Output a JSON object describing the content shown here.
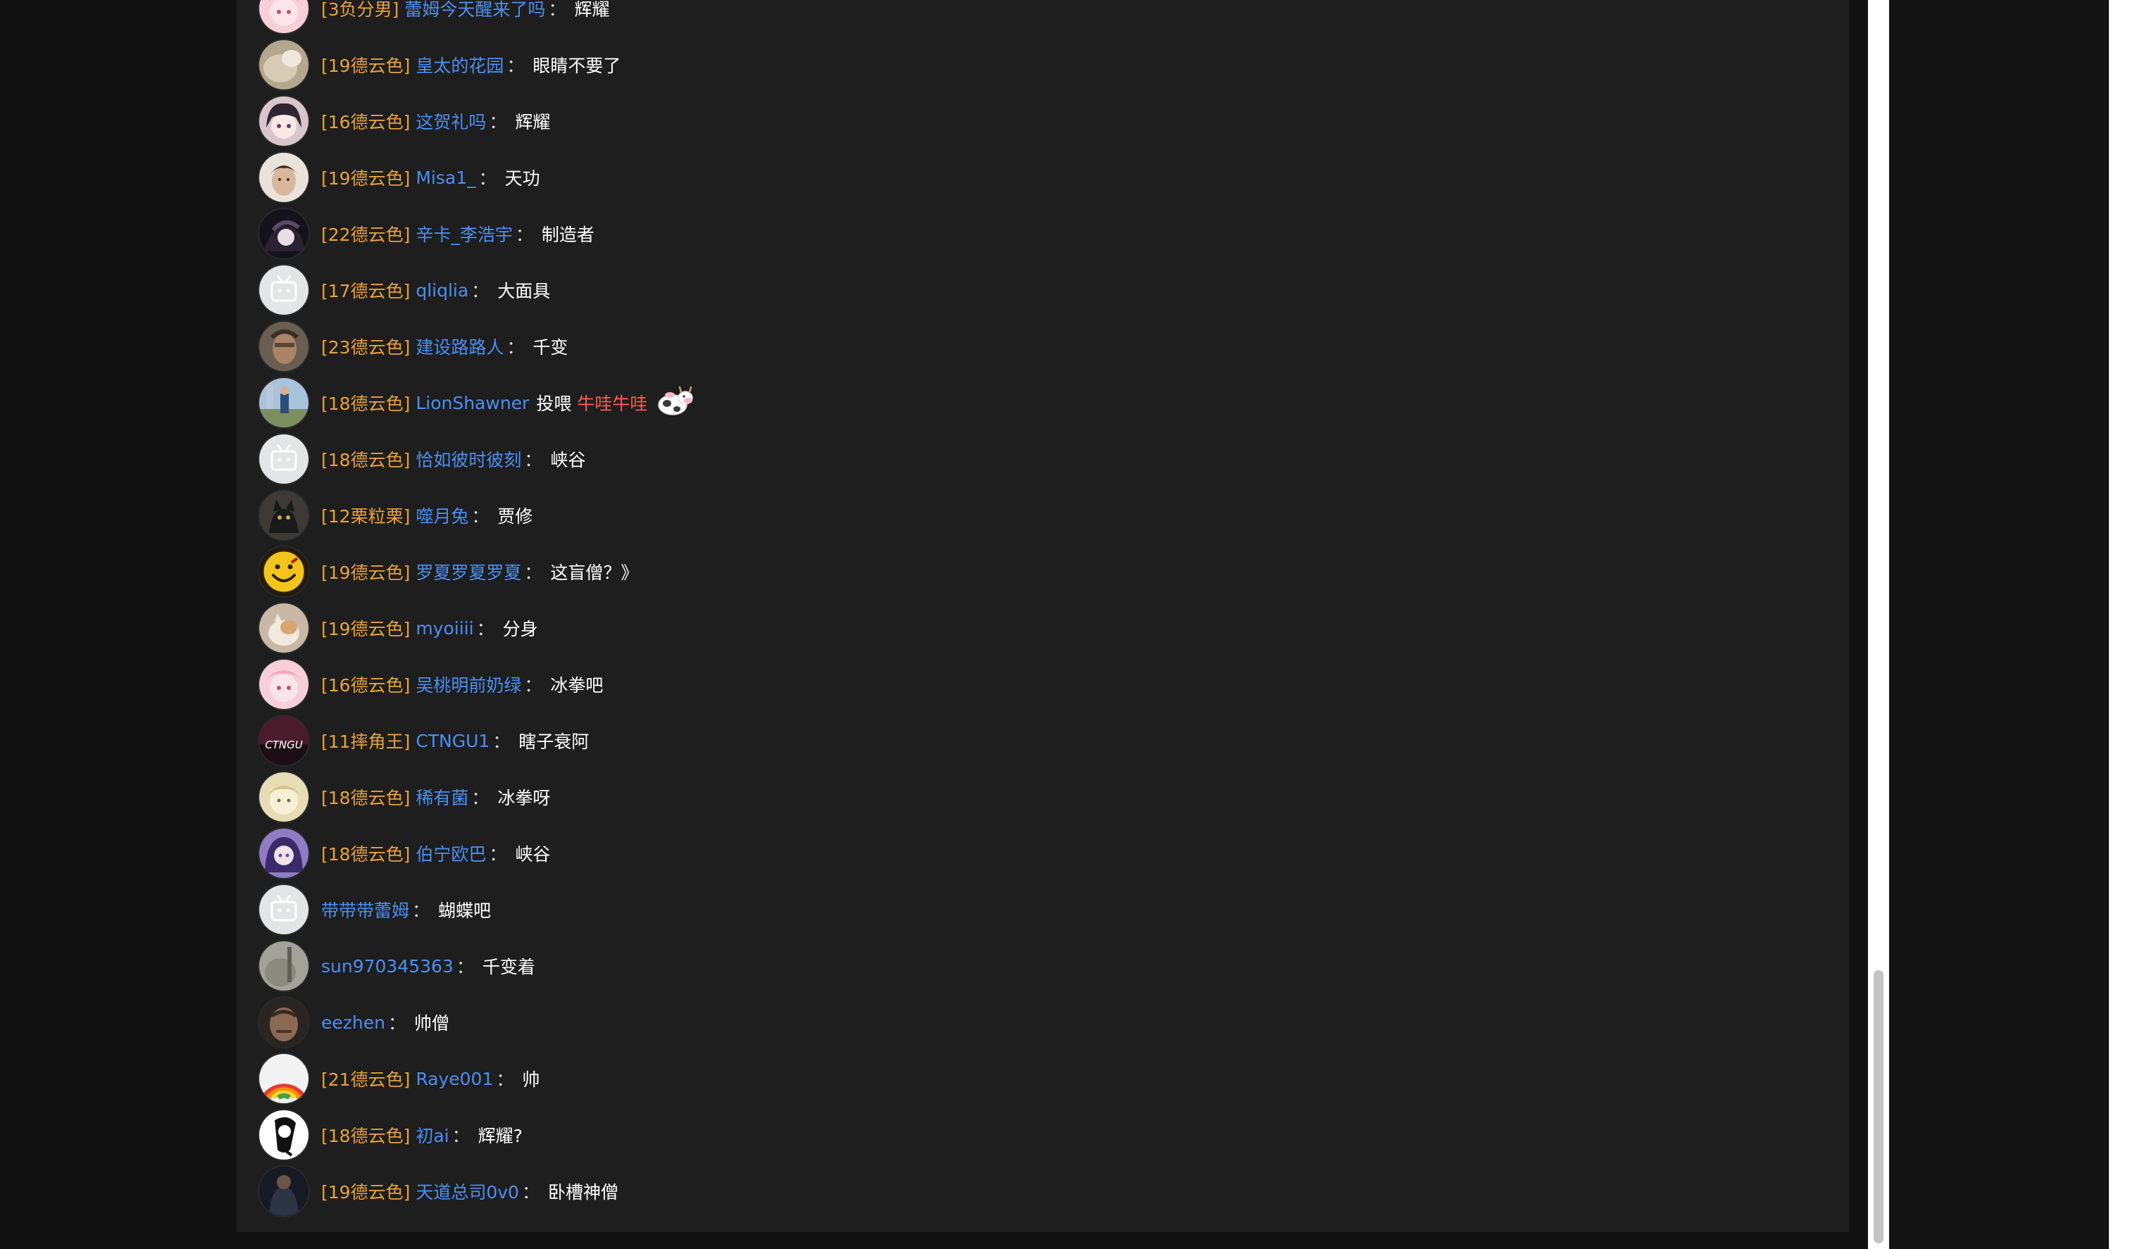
{
  "messages": [
    {
      "badge": "[3负分男]",
      "user": "蕾姆今天醒来了吗",
      "sep": "：",
      "text": "辉耀",
      "avatar": "avatar-pink-anime"
    },
    {
      "badge": "[19德云色]",
      "user": "皇太的花园",
      "sep": "：",
      "text": "眼睛不要了",
      "avatar": "avatar-beige-photo"
    },
    {
      "badge": "[16德云色]",
      "user": "这贺礼吗",
      "sep": "：",
      "text": "辉耀",
      "avatar": "avatar-anime-girl"
    },
    {
      "badge": "[19德云色]",
      "user": "Misa1_",
      "sep": "：",
      "text": "天功",
      "avatar": "avatar-face-photo"
    },
    {
      "badge": "[22德云色]",
      "user": "辛卡_李浩宇",
      "sep": "：",
      "text": "制造者",
      "avatar": "avatar-dark-anime"
    },
    {
      "badge": "[17德云色]",
      "user": "qliqlia",
      "sep": "：",
      "text": "大面具",
      "avatar": "avatar-default-tv"
    },
    {
      "badge": "[23德云色]",
      "user": "建设路路人",
      "sep": "：",
      "text": "千变",
      "avatar": "avatar-man-photo"
    },
    {
      "badge": "[18德云色]",
      "user": "LionShawner",
      "sep": "",
      "text": "",
      "gift_verb": "投喂",
      "gift_name": "牛哇牛哇",
      "avatar": "avatar-outdoor-photo",
      "gift_icon": "cow-gift-icon"
    },
    {
      "badge": "[18德云色]",
      "user": "恰如彼时彼刻",
      "sep": "：",
      "text": "峡谷",
      "avatar": "avatar-default-tv"
    },
    {
      "badge": "[12栗粒栗]",
      "user": "噬月兔",
      "sep": "：",
      "text": "贾修",
      "avatar": "avatar-black-cat"
    },
    {
      "badge": "[19德云色]",
      "user": "罗夏罗夏罗夏",
      "sep": "：",
      "text": "这盲僧？》",
      "avatar": "avatar-smiley"
    },
    {
      "badge": "[19德云色]",
      "user": "myoiiii",
      "sep": "：",
      "text": "分身",
      "avatar": "avatar-cat-photo"
    },
    {
      "badge": "[16德云色]",
      "user": "吴桃明前奶绿",
      "sep": "：",
      "text": "冰拳吧",
      "avatar": "avatar-pink-anime"
    },
    {
      "badge": "[11摔角王]",
      "user": "CTNGU1",
      "sep": "：",
      "text": "瞎子衰阿",
      "avatar": "avatar-ctngu-logo",
      "avatar_text": "CTNGU"
    },
    {
      "badge": "[18德云色]",
      "user": "稀有菌",
      "sep": "：",
      "text": "冰拳呀",
      "avatar": "avatar-cream-anime"
    },
    {
      "badge": "[18德云色]",
      "user": "伯宁欧巴",
      "sep": "：",
      "text": "峡谷",
      "avatar": "avatar-purple-anime"
    },
    {
      "badge": "",
      "user": "带带带蕾姆",
      "sep": "：",
      "text": "蝴蝶吧",
      "avatar": "avatar-default-tv"
    },
    {
      "badge": "",
      "user": "sun970345363",
      "sep": "：",
      "text": "千变着",
      "avatar": "avatar-gray-photo"
    },
    {
      "badge": "",
      "user": "eezhen",
      "sep": "：",
      "text": "帅僧",
      "avatar": "avatar-man-dark-photo"
    },
    {
      "badge": "[21德云色]",
      "user": "Raye001",
      "sep": "：",
      "text": "帅",
      "avatar": "avatar-rainbow"
    },
    {
      "badge": "[18德云色]",
      "user": "初ai",
      "sep": "：",
      "text": "辉耀?",
      "avatar": "avatar-bw-sketch"
    },
    {
      "badge": "[19德云色]",
      "user": "天道总司0v0",
      "sep": "：",
      "text": "卧槽神僧",
      "avatar": "avatar-dark-figure"
    }
  ],
  "colors": {
    "badge": "#e9a13b",
    "user": "#4b8ff2",
    "message": "#ffffff",
    "gift": "#ff5b4f",
    "panel": "#1e1e1e",
    "background": "#111111"
  }
}
